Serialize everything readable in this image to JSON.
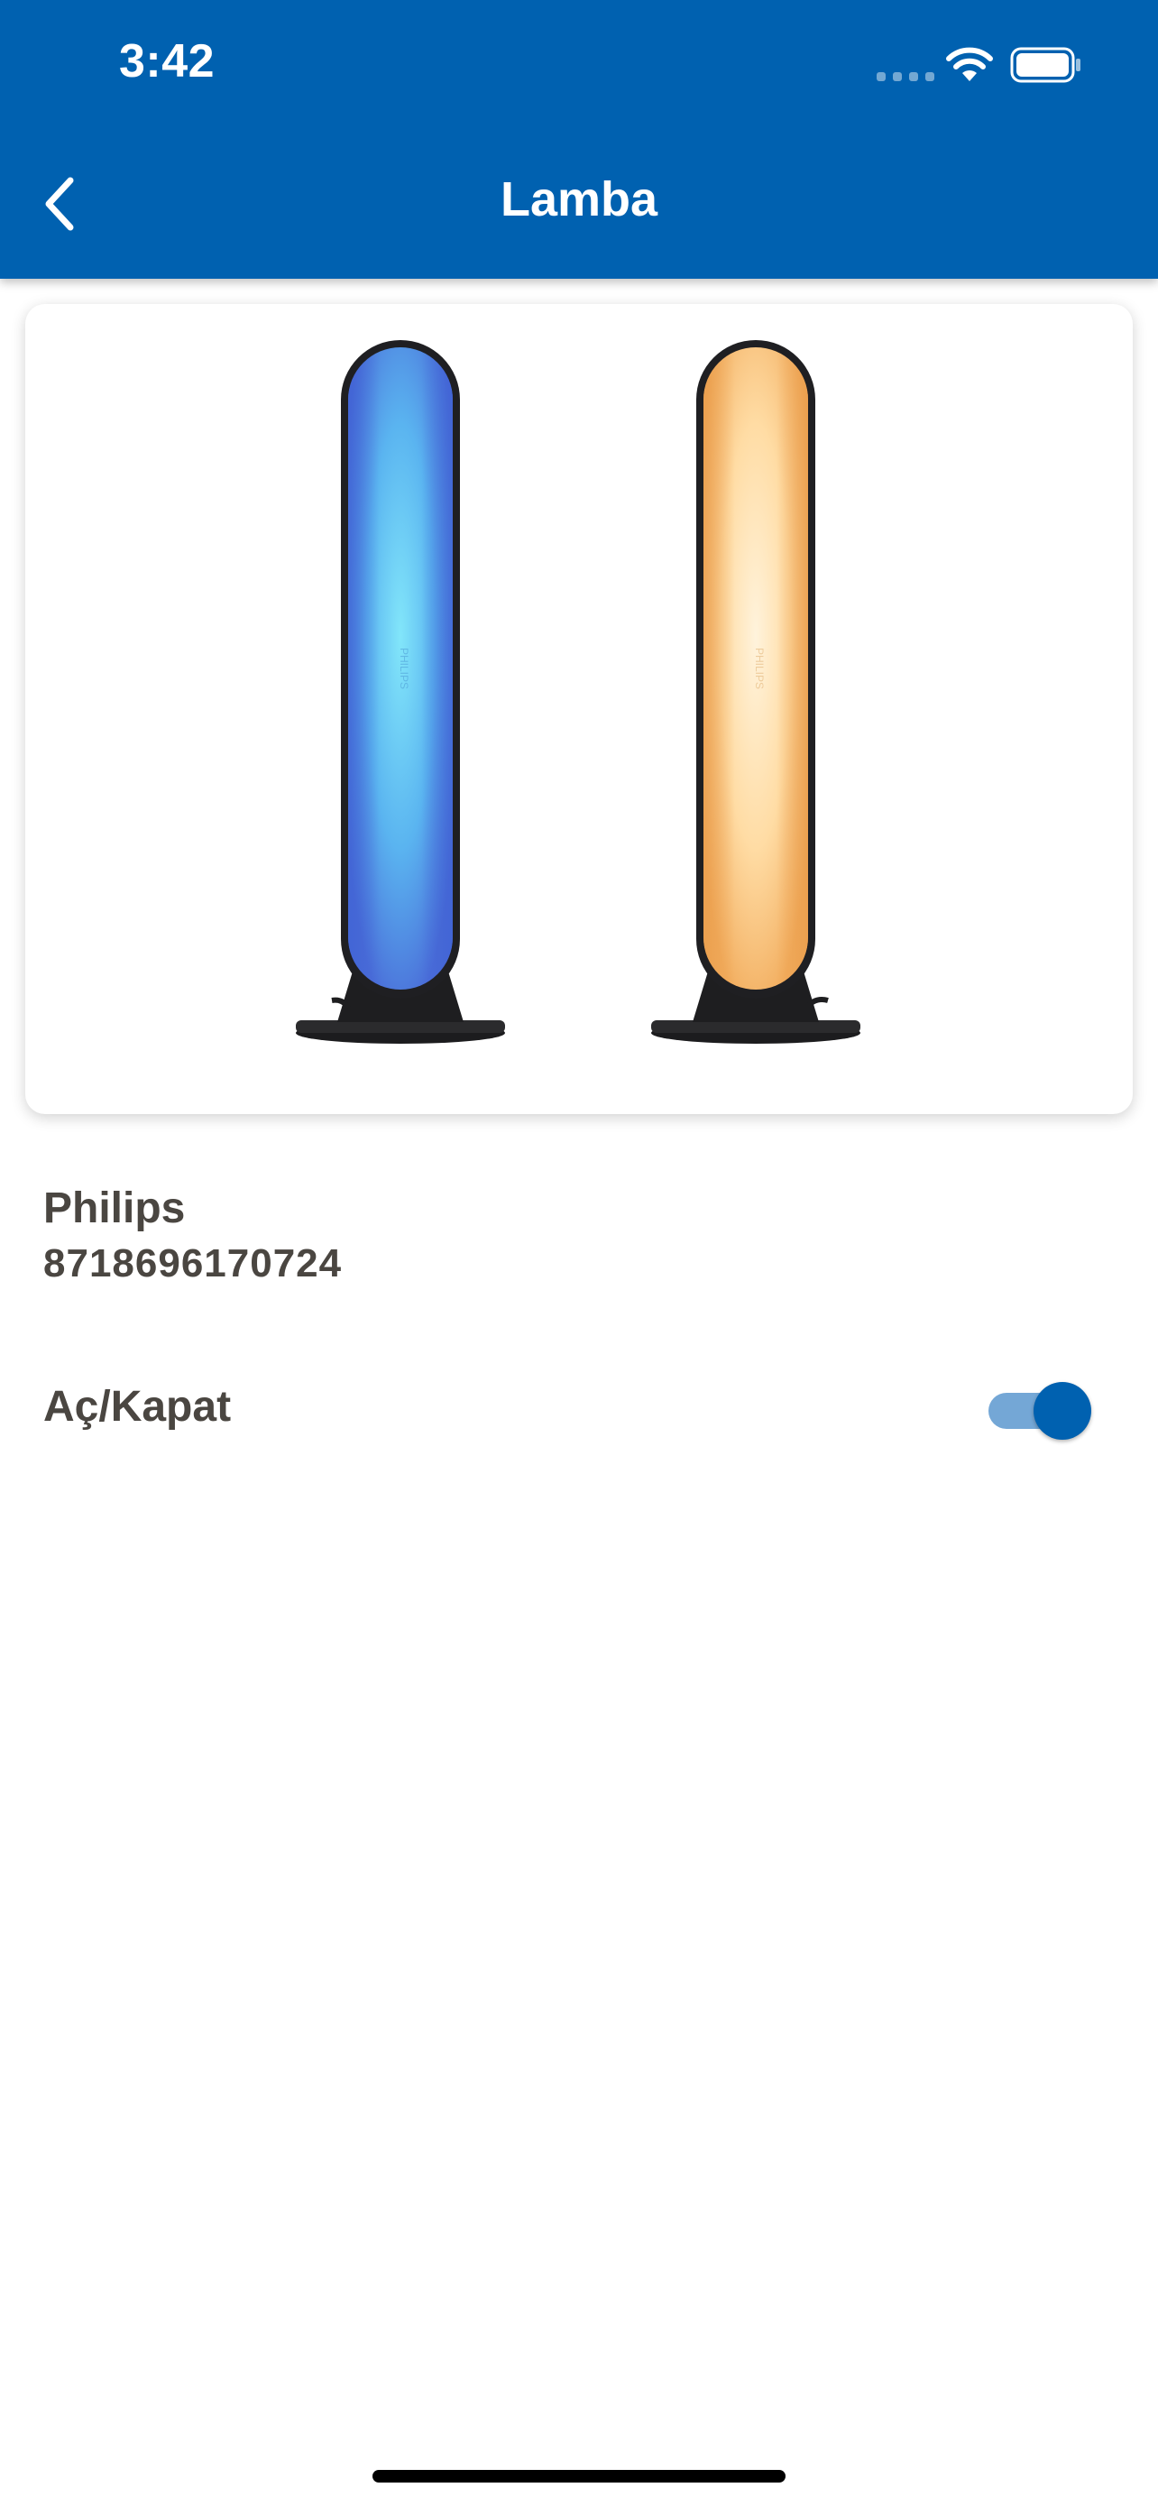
{
  "status_bar": {
    "time": "3:42",
    "battery_level": 1.0
  },
  "header": {
    "title": "Lamba",
    "back_icon": "chevron-left-icon"
  },
  "product": {
    "image_alt": "lamp-pair-image",
    "image_text": "PHILIPS",
    "brand": "Philips",
    "code": "8718696170724"
  },
  "controls": {
    "power_label": "Aç/Kapat",
    "power_on": true
  },
  "colors": {
    "header": "#0061b0",
    "accent": "#0061b0",
    "toggle_track": "#74a7d6",
    "text": "#4a4641"
  }
}
